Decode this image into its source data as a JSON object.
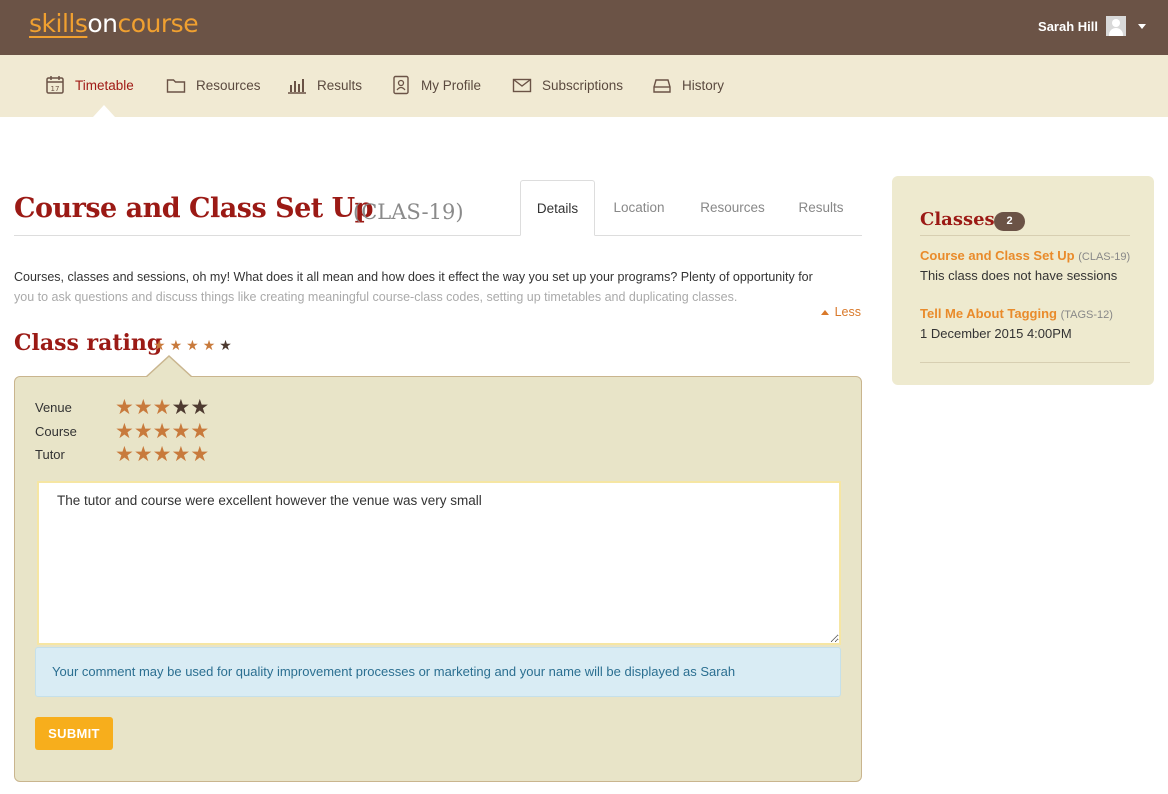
{
  "brand": {
    "part1": "skills",
    "part2": "on",
    "part3": "course"
  },
  "user": {
    "name": "Sarah Hill"
  },
  "nav": [
    {
      "label": "Timetable",
      "icon": "calendar-icon"
    },
    {
      "label": "Resources",
      "icon": "folder-icon"
    },
    {
      "label": "Results",
      "icon": "bar-chart-icon"
    },
    {
      "label": "My Profile",
      "icon": "profile-icon"
    },
    {
      "label": "Subscriptions",
      "icon": "envelope-icon"
    },
    {
      "label": "History",
      "icon": "archive-icon"
    }
  ],
  "page": {
    "title": "Course and Class Set Up",
    "code": "(CLAS-19)"
  },
  "tabs": [
    "Details",
    "Location",
    "Resources",
    "Results"
  ],
  "description": {
    "line1": "Courses, classes and sessions, oh my! What does it all mean and how does it effect the way you set up your programs? Plenty of opportunity for",
    "line2": "you to ask questions and discuss things like creating meaningful course-class codes, setting up timetables and duplicating classes.",
    "less_label": "Less"
  },
  "rating": {
    "heading": "Class rating",
    "overall": 4,
    "criteria": [
      {
        "label": "Venue",
        "value": 3
      },
      {
        "label": "Course",
        "value": 5
      },
      {
        "label": "Tutor",
        "value": 5
      }
    ],
    "comment": "The tutor and course were excellent however the venue was very small",
    "info": "Your comment may be used for quality improvement processes or marketing and your name will be displayed as Sarah",
    "submit_label": "SUBMIT"
  },
  "sidebar": {
    "heading": "Classes",
    "count": "2",
    "items": [
      {
        "title": "Course and Class Set Up",
        "code": "(CLAS-19)",
        "sub": "This class does not have sessions"
      },
      {
        "title": "Tell Me About Tagging",
        "code": "(TAGS-12)",
        "sub": "1 December 2015 4:00PM"
      }
    ]
  },
  "colors": {
    "header": "#6b5346",
    "nav_bg": "#f1ead3",
    "accent": "#9b1a15",
    "link": "#e98b2b",
    "submit": "#f7ae1c"
  }
}
